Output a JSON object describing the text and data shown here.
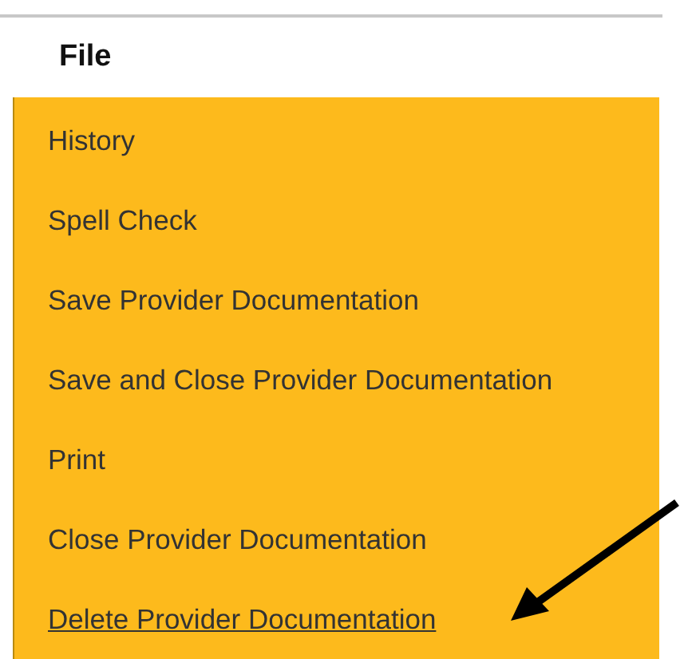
{
  "menu": {
    "title": "File",
    "items": [
      {
        "label": "History",
        "hovered": false
      },
      {
        "label": "Spell Check",
        "hovered": false
      },
      {
        "label": "Save Provider Documentation",
        "hovered": false
      },
      {
        "label": "Save and Close Provider Documentation",
        "hovered": false
      },
      {
        "label": "Print",
        "hovered": false
      },
      {
        "label": "Close Provider Documentation",
        "hovered": false
      },
      {
        "label": "Delete Provider Documentation",
        "hovered": true
      }
    ]
  }
}
